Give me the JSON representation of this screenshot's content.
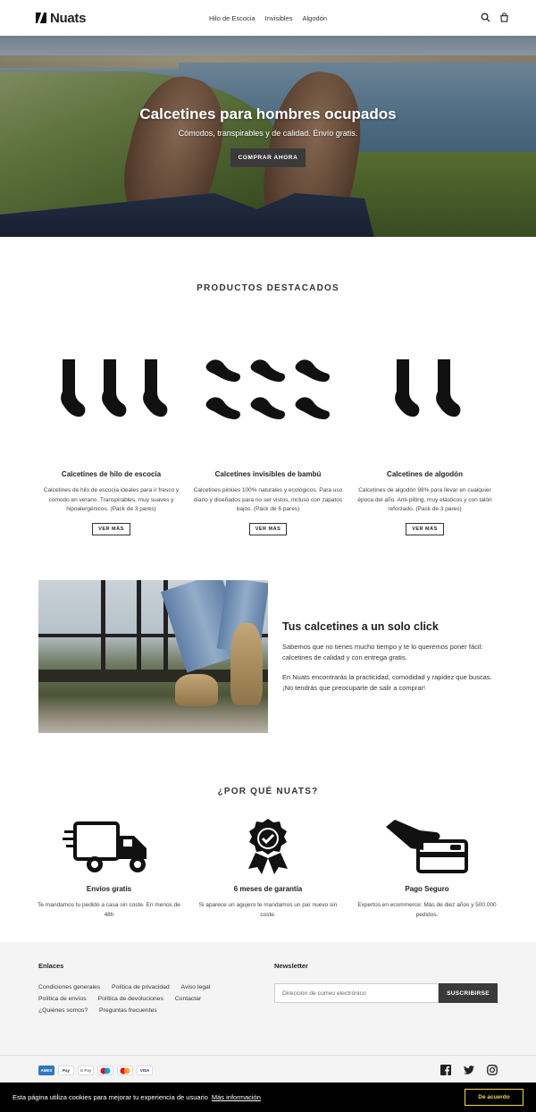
{
  "header": {
    "logo_text": "Nuats",
    "nav": [
      "Hilo de Escocia",
      "Invisibles",
      "Algodón"
    ]
  },
  "hero": {
    "title": "Calcetines para hombres ocupados",
    "subtitle": "Cómodos, transpirables y de calidad. Envío gratis.",
    "button": "COMPRAR AHORA"
  },
  "featured": {
    "title": "PRODUCTOS DESTACADOS",
    "products": [
      {
        "name": "Calcetines de hilo de escocia",
        "desc": "Calcetines de hilo de escocia ideales para ir fresco y cómodo en verano. Transpirables, muy suaves y hipoalergénicos. (Pack de 3 pares)",
        "button": "VER MÁS"
      },
      {
        "name": "Calcetines invisibles de bambú",
        "desc": "Calcetines pinkies 100% naturales y ecológicos. Para uso diario y diseñados para no ser vistos, incluso con zapatos bajos. (Pack de 6 pares)",
        "button": "VER MÁS"
      },
      {
        "name": "Calcetines de algodón",
        "desc": "Calcetines de algodón 98% para llevar en cualquier época del año. Anti-pilling, muy elásticos y con talón reforzado. (Pack de 3 pares)",
        "button": "VER MÁS"
      }
    ]
  },
  "feature": {
    "title": "Tus calcetines a un solo click",
    "p1": "Sabemos que no tienes mucho tiempo y te lo queremos poner fácil: calcetines de calidad y con entrega gratis.",
    "p2": "En Nuats encontrarás la practicidad, comodidad y rapidez que buscas. ¡No tendrás que preocuparte de salir a comprar!"
  },
  "why": {
    "title": "¿POR QUÉ NUATS?",
    "items": [
      {
        "icon": "truck-icon",
        "title": "Envíos gratis",
        "desc": "Te mandamos tu pedido a casa sin coste. En menos de 48h"
      },
      {
        "icon": "award-badge-icon",
        "title": "6 meses de garantía",
        "desc": "Si aparece un agujero te mandamos un par nuevo sin coste."
      },
      {
        "icon": "card-payment-icon",
        "title": "Pago Seguro",
        "desc": "Expertos en ecommerce: Más de diez años y 500.000 pedidos."
      }
    ]
  },
  "footer": {
    "links_title": "Enlaces",
    "links": [
      "Condiciones generales",
      "Política de privacidad",
      "Aviso legal",
      "Política de envíos",
      "Política de devoluciones",
      "Contactar",
      "¿Quiénes somos?",
      "Preguntas frecuentes"
    ],
    "newsletter_title": "Newsletter",
    "newsletter_placeholder": "Dirección de correo electrónico",
    "newsletter_button": "SUSCRIBIRSE",
    "payments": [
      "AMEX",
      "Pay",
      "G Pay",
      "maestro",
      "mastercard",
      "VISA"
    ]
  },
  "cookie": {
    "text": "Esta página utiliza cookies para mejorar tu experiencia de usuario",
    "more": "Más información",
    "accept": "De acuerdo",
    "accent": "#f1d94f"
  }
}
